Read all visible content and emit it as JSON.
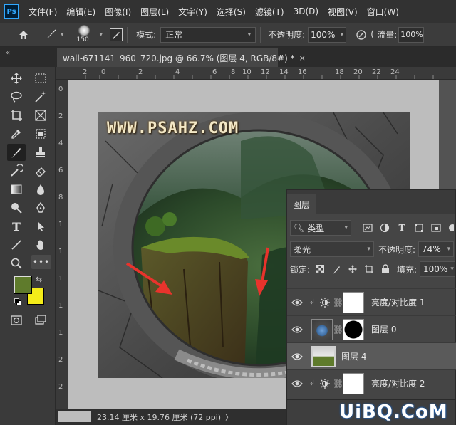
{
  "app": {
    "logo_text": "Ps"
  },
  "menu": [
    "文件(F)",
    "编辑(E)",
    "图像(I)",
    "图层(L)",
    "文字(Y)",
    "选择(S)",
    "滤镜(T)",
    "3D(D)",
    "视图(V)",
    "窗口(W)"
  ],
  "options_bar": {
    "brush_size": "150",
    "mode_label": "模式:",
    "mode_value": "正常",
    "opacity_label": "不透明度:",
    "opacity_value": "100%",
    "flow_label": "流量:",
    "flow_value": "100%"
  },
  "document": {
    "tab_title": "wall-671141_960_720.jpg @ 66.7% (图层 4, RGB/8#) *",
    "close_glyph": "×",
    "status": "23.14 厘米 x 19.76 厘米 (72 ppi)",
    "status_caret": "〉"
  },
  "ruler_top": [
    "2",
    "0",
    "2",
    "4",
    "6",
    "8",
    "10",
    "12",
    "14",
    "16",
    "18",
    "20",
    "22",
    "24"
  ],
  "ruler_left": [
    "0",
    "2",
    "4",
    "6",
    "8",
    "1",
    "1",
    "1",
    "1",
    "1",
    "2",
    "2"
  ],
  "photo_text": "WWW.PSAHZ.COM",
  "colors": {
    "foreground": "#5f7b2c",
    "background": "#f4ec19",
    "arrow": "#e8332c",
    "ps_blue": "#31a8ff"
  },
  "layers_panel": {
    "tab_label": "图层",
    "filter_label": "类型",
    "blend_mode": "柔光",
    "opacity_label": "不透明度:",
    "opacity_value": "74%",
    "lock_label": "锁定:",
    "fill_label": "填充:",
    "fill_value": "100%",
    "layers": [
      {
        "name": "亮度/对比度 1",
        "type": "adjustment",
        "clipped": true,
        "selected": false
      },
      {
        "name": "图层 0",
        "type": "pixel-with-mask",
        "clipped": false,
        "selected": false
      },
      {
        "name": "图层 4",
        "type": "pixel",
        "clipped": false,
        "selected": true
      },
      {
        "name": "亮度/对比度 2",
        "type": "adjustment",
        "clipped": true,
        "selected": false
      }
    ]
  },
  "watermark": "UiBQ.CoM"
}
